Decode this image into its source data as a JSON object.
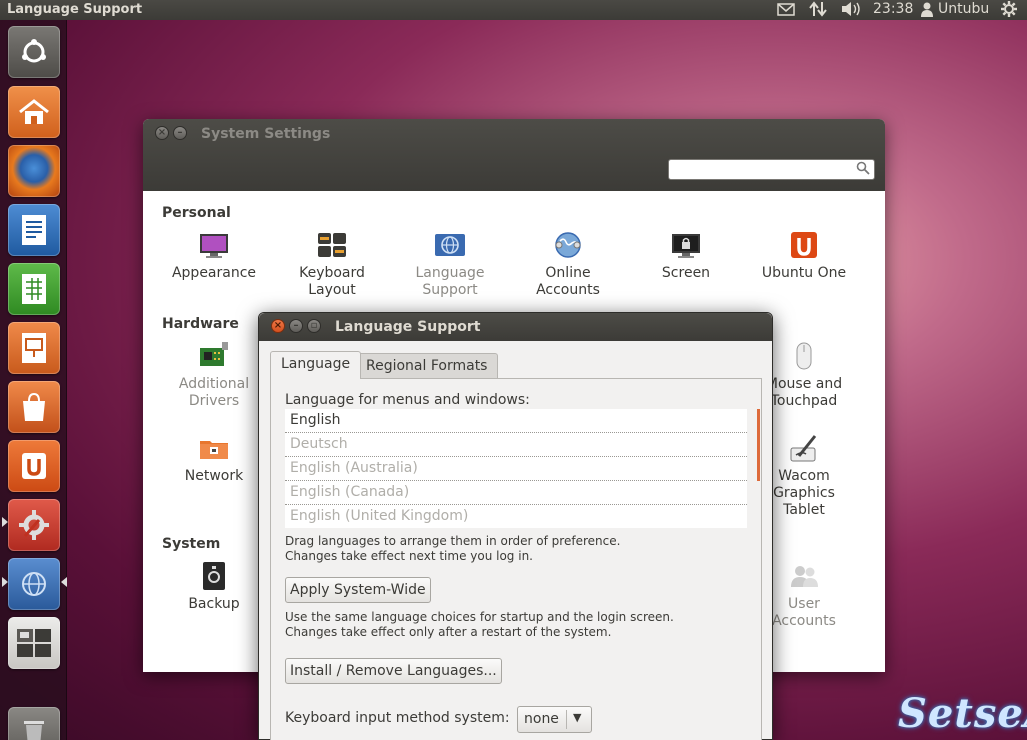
{
  "top_panel": {
    "title": "Language Support",
    "time": "23:38",
    "user": "Untubu",
    "icons": [
      "mail-icon",
      "network-icon",
      "volume-icon",
      "user-icon",
      "power-gear-icon"
    ]
  },
  "launcher": {
    "items": [
      "dash-home",
      "home-folder",
      "firefox",
      "libreoffice-writer",
      "libreoffice-calc",
      "libreoffice-impress",
      "software-center",
      "ubuntu-one",
      "system-settings",
      "language-support",
      "workspace-switcher",
      "trash"
    ]
  },
  "system_settings": {
    "title": "System Settings",
    "search_placeholder": "",
    "sections": {
      "personal": "Personal",
      "hardware": "Hardware",
      "system": "System"
    },
    "personal_items": [
      {
        "line1": "Appearance",
        "line2": ""
      },
      {
        "line1": "Keyboard",
        "line2": "Layout"
      },
      {
        "line1": "Language",
        "line2": "Support"
      },
      {
        "line1": "Online",
        "line2": "Accounts"
      },
      {
        "line1": "Screen",
        "line2": ""
      },
      {
        "line1": "Ubuntu One",
        "line2": ""
      }
    ],
    "hardware_items": [
      {
        "line1": "Additional",
        "line2": "Drivers"
      },
      {
        "line1": "Network",
        "line2": ""
      },
      {
        "line1": "Mouse and",
        "line2": "Touchpad"
      },
      {
        "line1": "Wacom",
        "line2": "Graphics",
        "line3": "Tablet"
      }
    ],
    "system_items": [
      {
        "line1": "Backup",
        "line2": ""
      },
      {
        "line1": "User",
        "line2": "Accounts"
      }
    ]
  },
  "language_support": {
    "title": "Language Support",
    "tabs": [
      "Language",
      "Regional Formats"
    ],
    "list_label": "Language for menus and windows:",
    "languages": [
      {
        "name": "English",
        "active": true
      },
      {
        "name": "Deutsch",
        "active": false
      },
      {
        "name": "English (Australia)",
        "active": false
      },
      {
        "name": "English (Canada)",
        "active": false
      },
      {
        "name": "English (United Kingdom)",
        "active": false
      }
    ],
    "drag_note_1": "Drag languages to arrange them in order of preference.",
    "drag_note_2": "Changes take effect next time you log in.",
    "apply_button": "Apply System-Wide",
    "apply_note_1": "Use the same language choices for startup and the login screen.",
    "apply_note_2": "Changes take effect only after a restart of the system.",
    "install_button": "Install / Remove Languages...",
    "input_method_label": "Keyboard input method system:",
    "input_method_value": "none"
  },
  "watermark": "SetseA",
  "colors": {
    "accent": "#dd4814",
    "panel": "#3c3b37",
    "scroll_thumb": "#dd6a3a"
  }
}
